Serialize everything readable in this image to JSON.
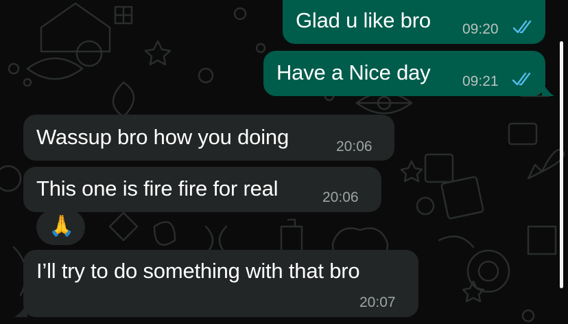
{
  "chat": {
    "messages": [
      {
        "direction": "outgoing",
        "text": "Glad u like bro",
        "time": "09:20",
        "status": "read"
      },
      {
        "direction": "outgoing",
        "text": "Have a Nice day",
        "time": "09:21",
        "status": "read"
      },
      {
        "direction": "incoming",
        "text": "Wassup bro how you doing",
        "time": "20:06"
      },
      {
        "direction": "incoming",
        "text": "This one is fire fire for real",
        "time": "20:06"
      },
      {
        "direction": "incoming",
        "text": "🙏",
        "time": ""
      },
      {
        "direction": "incoming",
        "text": "I’ll try to do something with that bro",
        "time": "20:07"
      }
    ]
  },
  "colors": {
    "background": "#0b0b0b",
    "outgoing_bubble": "#005c4b",
    "incoming_bubble": "#232626",
    "read_ticks": "#53bdeb"
  },
  "icons": {
    "read_receipt": "double-check-icon",
    "wallpaper": "doodle-pattern"
  }
}
